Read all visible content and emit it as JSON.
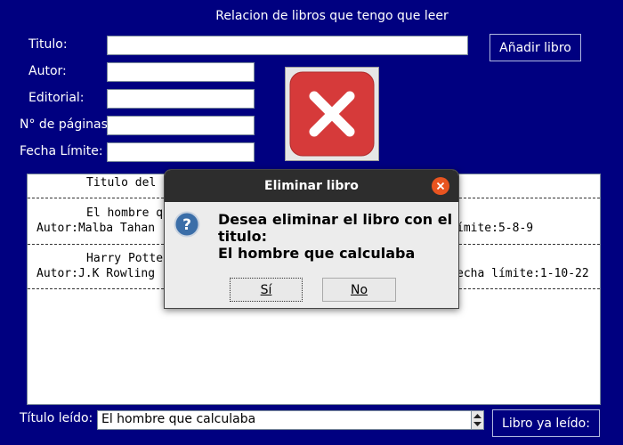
{
  "window": {
    "title": "Relacion de libros que tengo que leer"
  },
  "form": {
    "titulo_label": "Titulo:",
    "autor_label": "Autor:",
    "editorial_label": "Editorial:",
    "paginas_label": "N° de páginas:",
    "fecha_label": "Fecha Límite:",
    "titulo_value": "",
    "autor_value": "",
    "editorial_value": "",
    "paginas_value": "",
    "fecha_value": "",
    "add_button": "Añadir libro",
    "delete_icon": "delete-x-icon"
  },
  "list": {
    "header": "Titulo del",
    "entries": [
      {
        "line1": "El hombre q",
        "line2_left": "Autor:Malba Tahan",
        "line2_right": "ímite:5-8-9"
      },
      {
        "line1": "Harry Potte",
        "line2_left": "Autor:J.K Rowling",
        "line2_right": "echa límite:1-10-22"
      }
    ]
  },
  "bottom": {
    "label": "Título leído:",
    "value": "El hombre que calculaba",
    "button": "Libro ya leído:"
  },
  "dialog": {
    "title": "Eliminar libro",
    "message_line1": "Desea eliminar el libro con el",
    "message_line2": "titulo:",
    "message_line3": "El hombre que calculaba",
    "yes": "Sí",
    "no": "No",
    "icon": "question-icon"
  },
  "colors": {
    "background": "#000080",
    "delete_red": "#d63a3a",
    "close_orange": "#e95420",
    "question_blue": "#3b6ea8"
  }
}
